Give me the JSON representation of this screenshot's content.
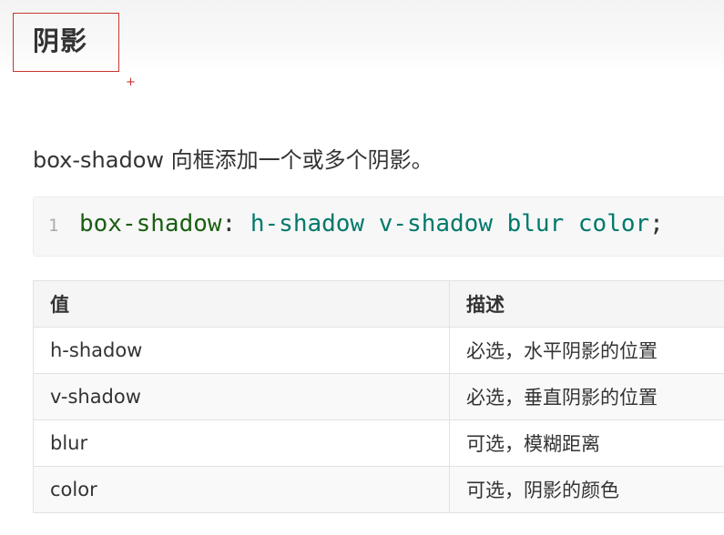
{
  "heading": "阴影",
  "cursor_glyph": "+",
  "intro": "box-shadow 向框添加一个或多个阴影。",
  "code": {
    "line_number": "1",
    "property": "box-shadow",
    "colon": ":",
    "values": "h-shadow v-shadow blur color",
    "semicolon": ";"
  },
  "table": {
    "headers": [
      "值",
      "描述"
    ],
    "rows": [
      [
        "h-shadow",
        "必选，水平阴影的位置"
      ],
      [
        "v-shadow",
        "必选，垂直阴影的位置"
      ],
      [
        "blur",
        "可选，模糊距离"
      ],
      [
        "color",
        "可选，阴影的颜色"
      ]
    ]
  },
  "colors": {
    "highlight_border": "#c8362e",
    "code_property": "#1a5e12",
    "code_value": "#00796b"
  }
}
